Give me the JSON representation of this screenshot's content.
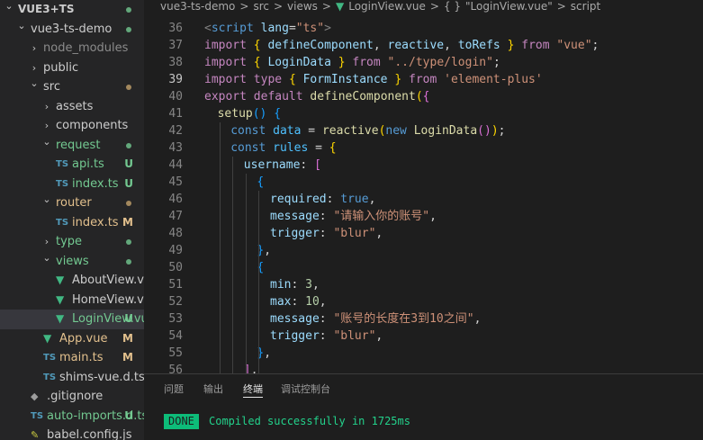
{
  "explorer": {
    "items": [
      {
        "label": "VUE3+TS",
        "kind": "root",
        "chevron": "open",
        "depth": 0,
        "icon": "",
        "status": "dot-green",
        "tone": ""
      },
      {
        "label": "vue3-ts-demo",
        "kind": "folder",
        "chevron": "open",
        "depth": 1,
        "icon": "",
        "status": "dot-green",
        "tone": ""
      },
      {
        "label": "node_modules",
        "kind": "folder",
        "chevron": "closed",
        "depth": 2,
        "icon": "",
        "status": "",
        "tone": "dim"
      },
      {
        "label": "public",
        "kind": "folder",
        "chevron": "closed",
        "depth": 2,
        "icon": "",
        "status": "",
        "tone": ""
      },
      {
        "label": "src",
        "kind": "folder",
        "chevron": "open",
        "depth": 2,
        "icon": "",
        "status": "dot-gold",
        "tone": ""
      },
      {
        "label": "assets",
        "kind": "folder",
        "chevron": "closed",
        "depth": 3,
        "icon": "",
        "status": "",
        "tone": ""
      },
      {
        "label": "components",
        "kind": "folder",
        "chevron": "closed",
        "depth": 3,
        "icon": "",
        "status": "",
        "tone": ""
      },
      {
        "label": "request",
        "kind": "folder",
        "chevron": "open",
        "depth": 3,
        "icon": "",
        "status": "dot-green",
        "tone": "untracked"
      },
      {
        "label": "api.ts",
        "kind": "file",
        "chevron": "",
        "depth": 4,
        "icon": "TS",
        "status": "U",
        "tone": "untracked"
      },
      {
        "label": "index.ts",
        "kind": "file",
        "chevron": "",
        "depth": 4,
        "icon": "TS",
        "status": "U",
        "tone": "untracked"
      },
      {
        "label": "router",
        "kind": "folder",
        "chevron": "open",
        "depth": 3,
        "icon": "",
        "status": "dot-gold",
        "tone": "mod"
      },
      {
        "label": "index.ts",
        "kind": "file",
        "chevron": "",
        "depth": 4,
        "icon": "TS",
        "status": "M",
        "tone": "mod"
      },
      {
        "label": "type",
        "kind": "folder",
        "chevron": "closed",
        "depth": 3,
        "icon": "",
        "status": "dot-green",
        "tone": "untracked"
      },
      {
        "label": "views",
        "kind": "folder",
        "chevron": "open",
        "depth": 3,
        "icon": "",
        "status": "dot-green",
        "tone": "untracked"
      },
      {
        "label": "AboutView.vue",
        "kind": "file",
        "chevron": "",
        "depth": 4,
        "icon": "V",
        "status": "",
        "tone": ""
      },
      {
        "label": "HomeView.vue",
        "kind": "file",
        "chevron": "",
        "depth": 4,
        "icon": "V",
        "status": "",
        "tone": ""
      },
      {
        "label": "LoginView.vue",
        "kind": "file",
        "chevron": "",
        "depth": 4,
        "icon": "V",
        "status": "U",
        "tone": "untracked",
        "selected": true
      },
      {
        "label": "App.vue",
        "kind": "file",
        "chevron": "",
        "depth": 3,
        "icon": "V",
        "status": "M",
        "tone": "mod"
      },
      {
        "label": "main.ts",
        "kind": "file",
        "chevron": "",
        "depth": 3,
        "icon": "TS",
        "status": "M",
        "tone": "mod"
      },
      {
        "label": "shims-vue.d.ts",
        "kind": "file",
        "chevron": "",
        "depth": 3,
        "icon": "TS",
        "status": "",
        "tone": ""
      },
      {
        "label": ".gitignore",
        "kind": "file",
        "chevron": "",
        "depth": 2,
        "icon": "git",
        "status": "",
        "tone": ""
      },
      {
        "label": "auto-imports.d.ts",
        "kind": "file",
        "chevron": "",
        "depth": 2,
        "icon": "TS",
        "status": "U",
        "tone": "untracked"
      },
      {
        "label": "babel.config.js",
        "kind": "file",
        "chevron": "",
        "depth": 2,
        "icon": "JS",
        "status": "",
        "tone": ""
      }
    ]
  },
  "breadcrumb": {
    "items": [
      "vue3-ts-demo",
      ">",
      "src",
      ">",
      "views",
      ">",
      "V",
      "LoginView.vue",
      ">",
      "{ }",
      "\"LoginView.vue\"",
      ">",
      "script"
    ]
  },
  "editor": {
    "active_line": "39",
    "lines": [
      {
        "no": "36",
        "indent": 0,
        "tokens": [
          [
            "<",
            "p"
          ],
          [
            "script",
            "k"
          ],
          [
            " ",
            ""
          ],
          [
            "lang",
            "v"
          ],
          [
            "=",
            ""
          ],
          [
            "\"ts\"",
            "s"
          ],
          [
            ">",
            "p"
          ]
        ]
      },
      {
        "no": "37",
        "indent": 0,
        "tokens": [
          [
            "import",
            "kc"
          ],
          [
            " ",
            ""
          ],
          [
            "{",
            "b1"
          ],
          [
            " ",
            ""
          ],
          [
            "defineComponent",
            "v"
          ],
          [
            ", ",
            ""
          ],
          [
            "reactive",
            "v"
          ],
          [
            ", ",
            ""
          ],
          [
            "toRefs",
            "v"
          ],
          [
            " ",
            ""
          ],
          [
            "}",
            "b1"
          ],
          [
            " ",
            ""
          ],
          [
            "from",
            "kc"
          ],
          [
            " ",
            ""
          ],
          [
            "\"vue\"",
            "s"
          ],
          [
            ";",
            ""
          ]
        ]
      },
      {
        "no": "38",
        "indent": 0,
        "tokens": [
          [
            "import",
            "kc"
          ],
          [
            " ",
            ""
          ],
          [
            "{",
            "b1"
          ],
          [
            " ",
            ""
          ],
          [
            "LoginData",
            "v"
          ],
          [
            " ",
            ""
          ],
          [
            "}",
            "b1"
          ],
          [
            " ",
            ""
          ],
          [
            "from",
            "kc"
          ],
          [
            " ",
            ""
          ],
          [
            "\"../type/login\"",
            "s"
          ],
          [
            ";",
            ""
          ]
        ]
      },
      {
        "no": "39",
        "indent": 0,
        "tokens": [
          [
            "import",
            "kc"
          ],
          [
            " ",
            ""
          ],
          [
            "type",
            "kc"
          ],
          [
            " ",
            ""
          ],
          [
            "{",
            "b1"
          ],
          [
            " ",
            ""
          ],
          [
            "FormInstance",
            "v"
          ],
          [
            " ",
            ""
          ],
          [
            "}",
            "b1"
          ],
          [
            " ",
            ""
          ],
          [
            "from",
            "kc"
          ],
          [
            " ",
            ""
          ],
          [
            "'element-plus'",
            "s"
          ]
        ]
      },
      {
        "no": "40",
        "indent": 0,
        "tokens": [
          [
            "export",
            "kc"
          ],
          [
            " ",
            ""
          ],
          [
            "default",
            "kc"
          ],
          [
            " ",
            ""
          ],
          [
            "defineComponent",
            "f"
          ],
          [
            "(",
            "b1"
          ],
          [
            "{",
            "b2"
          ]
        ]
      },
      {
        "no": "41",
        "indent": 1,
        "tokens": [
          [
            "setup",
            "f"
          ],
          [
            "()",
            "b3"
          ],
          [
            " ",
            ""
          ],
          [
            "{",
            "b3"
          ]
        ]
      },
      {
        "no": "42",
        "indent": 2,
        "tokens": [
          [
            "const",
            "k"
          ],
          [
            " ",
            ""
          ],
          [
            "data",
            "c"
          ],
          [
            " = ",
            ""
          ],
          [
            "reactive",
            "f"
          ],
          [
            "(",
            "b1"
          ],
          [
            "new",
            "k"
          ],
          [
            " ",
            ""
          ],
          [
            "LoginData",
            "f"
          ],
          [
            "()",
            "b2"
          ],
          [
            ")",
            "b1"
          ],
          [
            ";",
            ""
          ]
        ]
      },
      {
        "no": "43",
        "indent": 2,
        "tokens": [
          [
            "const",
            "k"
          ],
          [
            " ",
            ""
          ],
          [
            "rules",
            "c"
          ],
          [
            " = ",
            ""
          ],
          [
            "{",
            "b1"
          ]
        ]
      },
      {
        "no": "44",
        "indent": 3,
        "tokens": [
          [
            "username",
            "v"
          ],
          [
            ": ",
            ""
          ],
          [
            "[",
            "b2"
          ]
        ]
      },
      {
        "no": "45",
        "indent": 4,
        "tokens": [
          [
            "{",
            "b3"
          ]
        ]
      },
      {
        "no": "46",
        "indent": 5,
        "tokens": [
          [
            "required",
            "v"
          ],
          [
            ": ",
            ""
          ],
          [
            "true",
            "k"
          ],
          [
            ",",
            ""
          ]
        ]
      },
      {
        "no": "47",
        "indent": 5,
        "tokens": [
          [
            "message",
            "v"
          ],
          [
            ": ",
            ""
          ],
          [
            "\"请输入你的账号\"",
            "s"
          ],
          [
            ",",
            ""
          ]
        ]
      },
      {
        "no": "48",
        "indent": 5,
        "tokens": [
          [
            "trigger",
            "v"
          ],
          [
            ": ",
            ""
          ],
          [
            "\"blur\"",
            "s"
          ],
          [
            ",",
            ""
          ]
        ]
      },
      {
        "no": "49",
        "indent": 4,
        "tokens": [
          [
            "}",
            "b3"
          ],
          [
            ",",
            ""
          ]
        ]
      },
      {
        "no": "50",
        "indent": 4,
        "tokens": [
          [
            "{",
            "b3"
          ]
        ]
      },
      {
        "no": "51",
        "indent": 5,
        "tokens": [
          [
            "min",
            "v"
          ],
          [
            ": ",
            ""
          ],
          [
            "3",
            "n"
          ],
          [
            ",",
            ""
          ]
        ]
      },
      {
        "no": "52",
        "indent": 5,
        "tokens": [
          [
            "max",
            "v"
          ],
          [
            ": ",
            ""
          ],
          [
            "10",
            "n"
          ],
          [
            ",",
            ""
          ]
        ]
      },
      {
        "no": "53",
        "indent": 5,
        "tokens": [
          [
            "message",
            "v"
          ],
          [
            ": ",
            ""
          ],
          [
            "\"账号的长度在3到10之间\"",
            "s"
          ],
          [
            ",",
            ""
          ]
        ]
      },
      {
        "no": "54",
        "indent": 5,
        "tokens": [
          [
            "trigger",
            "v"
          ],
          [
            ": ",
            ""
          ],
          [
            "\"blur\"",
            "s"
          ],
          [
            ",",
            ""
          ]
        ]
      },
      {
        "no": "55",
        "indent": 4,
        "tokens": [
          [
            "}",
            "b3"
          ],
          [
            ",",
            ""
          ]
        ]
      },
      {
        "no": "56",
        "indent": 3,
        "tokens": [
          [
            "]",
            "b2"
          ],
          [
            ",",
            ""
          ]
        ]
      }
    ]
  },
  "panel": {
    "tabs": [
      {
        "label": "问题",
        "active": false
      },
      {
        "label": "输出",
        "active": false
      },
      {
        "label": "终端",
        "active": true
      },
      {
        "label": "调试控制台",
        "active": false
      }
    ],
    "terminal": {
      "badge": "DONE",
      "message": "Compiled successfully in 1725ms"
    }
  },
  "colors": {
    "sidebar_bg": "#252526",
    "editor_bg": "#1e1e1e",
    "vue_green": "#41b883",
    "ts_blue": "#519aba",
    "untracked_green": "#73c991",
    "modified_gold": "#e2c08d",
    "done_green": "#0dbc79"
  }
}
